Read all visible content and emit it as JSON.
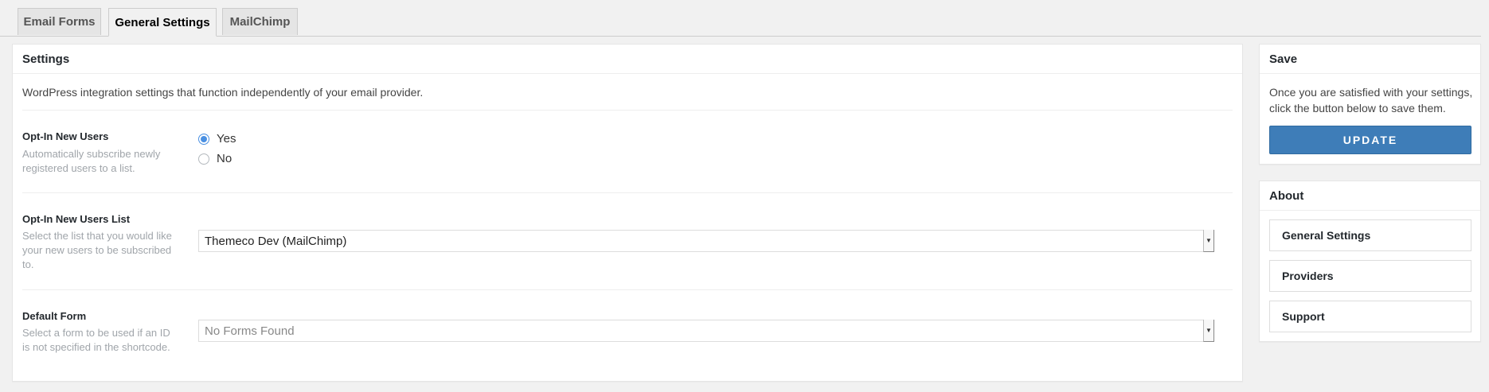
{
  "tabs": [
    {
      "label": "Email Forms"
    },
    {
      "label": "General Settings",
      "active": true
    },
    {
      "label": "MailChimp"
    }
  ],
  "settings": {
    "title": "Settings",
    "intro": "WordPress integration settings that function independently of your email provider.",
    "opt_in": {
      "label": "Opt-In New Users",
      "desc": "Automatically subscribe newly registered users to a list.",
      "options": [
        {
          "label": "Yes",
          "checked": true
        },
        {
          "label": "No",
          "checked": false
        }
      ]
    },
    "opt_in_list": {
      "label": "Opt-In New Users List",
      "desc": "Select the list that you would like your new users to be subscribed to.",
      "selected": "Themeco Dev (MailChimp)"
    },
    "default_form": {
      "label": "Default Form",
      "desc": "Select a form to be used if an ID is not specified in the shortcode.",
      "selected": "No Forms Found"
    }
  },
  "save": {
    "title": "Save",
    "text": "Once you are satisfied with your settings, click the button below to save them.",
    "button": "UPDATE"
  },
  "about": {
    "title": "About",
    "links": [
      "General Settings",
      "Providers",
      "Support"
    ]
  },
  "colors": {
    "accent": "#3e7db8",
    "radio_checked": "#4a90e2",
    "background": "#f1f1f1"
  }
}
